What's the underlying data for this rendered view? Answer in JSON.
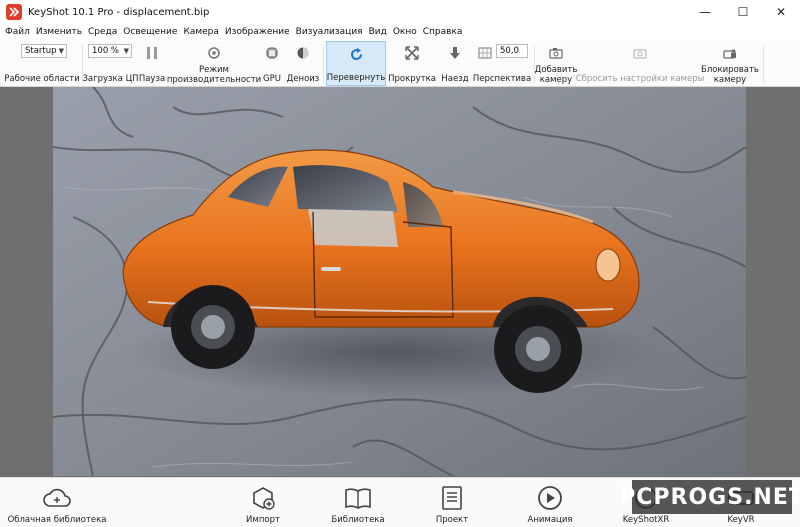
{
  "window": {
    "title": "KeyShot 10.1 Pro  -  displacement.bip",
    "minimize": "—",
    "maximize": "☐",
    "close": "✕"
  },
  "menu": [
    {
      "label": "Файл"
    },
    {
      "label": "Изменить"
    },
    {
      "label": "Среда"
    },
    {
      "label": "Освещение"
    },
    {
      "label": "Камера"
    },
    {
      "label": "Изображение"
    },
    {
      "label": "Визуализация"
    },
    {
      "label": "Вид"
    },
    {
      "label": "Окно"
    },
    {
      "label": "Справка"
    }
  ],
  "toolbar": {
    "workspace_value": "Startup",
    "workspace_label": "Рабочие области",
    "cpu_value": "100 %",
    "cpu_label": "Загрузка ЦП",
    "pause_label": "Пауза",
    "perf_mode_label_1": "Режим",
    "perf_mode_label_2": "производительности",
    "gpu_label": "GPU",
    "denoise_label": "Деноиз",
    "tumble_label": "Перевернуть",
    "pan_label": "Прокрутка",
    "dolly_label": "Наезд",
    "perspective_value": "50,0",
    "perspective_label": "Перспектива",
    "add_camera_label_1": "Добавить",
    "add_camera_label_2": "камеру",
    "reset_camera_label": "Сбросить настройки камеры",
    "lock_camera_label_1": "Блокировать",
    "lock_camera_label_2": "камеру"
  },
  "bottom": {
    "cloud_library": "Облачная библиотека",
    "import": "Импорт",
    "library": "Библиотека",
    "project": "Проект",
    "animation": "Анимация",
    "keyshotxr": "KeyShotXR",
    "keyvr": "KeyVR"
  },
  "watermark": "PCPROGS.NET",
  "colors": {
    "accent_active": "#d6e9f8",
    "car_orange": "#e8731e",
    "background_stone": "#8a8f99",
    "viewport_border": "#6f6f6f"
  }
}
